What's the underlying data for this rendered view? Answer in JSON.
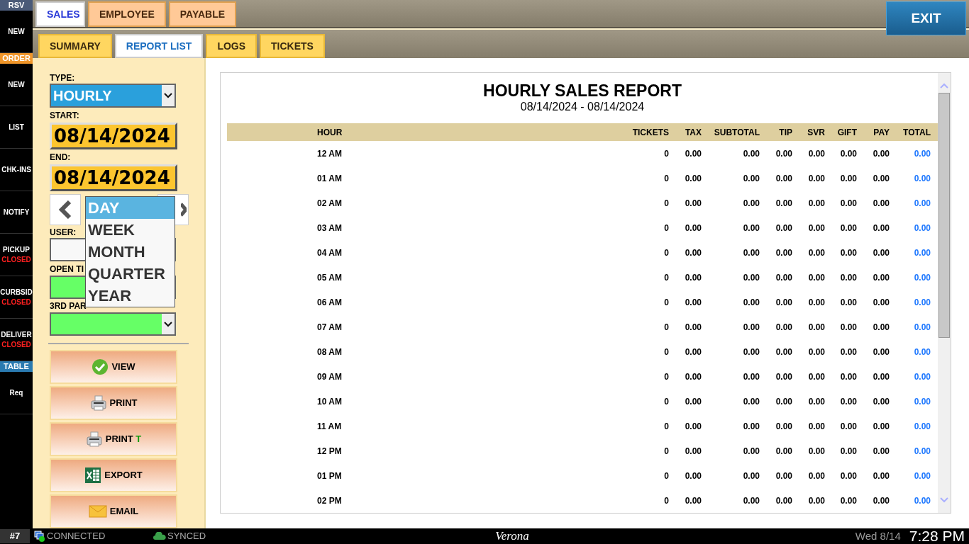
{
  "sidebar": [
    {
      "kind": "header",
      "label": "RSV",
      "color": "#4a5a78"
    },
    {
      "kind": "button",
      "label": "NEW"
    },
    {
      "kind": "header",
      "label": "ORDER",
      "color": "#f0962a"
    },
    {
      "kind": "button",
      "label": "NEW"
    },
    {
      "kind": "button",
      "label": "LIST"
    },
    {
      "kind": "button",
      "label": "CHK-INS"
    },
    {
      "kind": "button",
      "label": "NOTIFY"
    },
    {
      "kind": "button",
      "label": "PICKUP",
      "status": "CLOSED"
    },
    {
      "kind": "button",
      "label": "CURBSID",
      "status": "CLOSED"
    },
    {
      "kind": "button",
      "label": "DELIVER",
      "status": "CLOSED"
    },
    {
      "kind": "header",
      "label": "TABLE",
      "color": "#2a7ab0"
    },
    {
      "kind": "button",
      "label": "Req"
    }
  ],
  "tabs": [
    {
      "label": "SALES",
      "selected": true
    },
    {
      "label": "EMPLOYEE",
      "selected": false
    },
    {
      "label": "PAYABLE",
      "selected": false
    }
  ],
  "exit_button": "EXIT",
  "subtabs": [
    {
      "label": "SUMMARY",
      "selected": false
    },
    {
      "label": "REPORT LIST",
      "selected": true
    },
    {
      "label": "LOGS",
      "selected": false
    },
    {
      "label": "TICKETS",
      "selected": false
    }
  ],
  "filters": {
    "type_label": "TYPE:",
    "type_value": "HOURLY",
    "start_label": "START:",
    "start_value": "08/14/2024",
    "end_label": "END:",
    "end_value": "08/14/2024",
    "user_label": "USER:",
    "open_tickets_label": "OPEN TI",
    "third_party_label": "3RD PAR"
  },
  "period_menu": [
    {
      "label": "DAY",
      "selected": true
    },
    {
      "label": "WEEK",
      "selected": false
    },
    {
      "label": "MONTH",
      "selected": false
    },
    {
      "label": "QUARTER",
      "selected": false
    },
    {
      "label": "YEAR",
      "selected": false
    }
  ],
  "actions": [
    {
      "kind": "check",
      "label": "VIEW"
    },
    {
      "kind": "printer",
      "label": "PRINT"
    },
    {
      "kind": "printer",
      "label": "PRINT",
      "suffix": "T"
    },
    {
      "kind": "excel",
      "label": "EXPORT"
    },
    {
      "kind": "mail",
      "label": "EMAIL"
    }
  ],
  "report": {
    "title": "HOURLY SALES REPORT",
    "date_range": "08/14/2024 - 08/14/2024",
    "columns": [
      "HOUR",
      "TICKETS",
      "TAX",
      "SUBTOTAL",
      "TIP",
      "SVR",
      "GIFT",
      "PAY",
      "TOTAL"
    ],
    "rows": [
      [
        "12 AM",
        "0",
        "0.00",
        "0.00",
        "0.00",
        "0.00",
        "0.00",
        "0.00",
        "0.00"
      ],
      [
        "01 AM",
        "0",
        "0.00",
        "0.00",
        "0.00",
        "0.00",
        "0.00",
        "0.00",
        "0.00"
      ],
      [
        "02 AM",
        "0",
        "0.00",
        "0.00",
        "0.00",
        "0.00",
        "0.00",
        "0.00",
        "0.00"
      ],
      [
        "03 AM",
        "0",
        "0.00",
        "0.00",
        "0.00",
        "0.00",
        "0.00",
        "0.00",
        "0.00"
      ],
      [
        "04 AM",
        "0",
        "0.00",
        "0.00",
        "0.00",
        "0.00",
        "0.00",
        "0.00",
        "0.00"
      ],
      [
        "05 AM",
        "0",
        "0.00",
        "0.00",
        "0.00",
        "0.00",
        "0.00",
        "0.00",
        "0.00"
      ],
      [
        "06 AM",
        "0",
        "0.00",
        "0.00",
        "0.00",
        "0.00",
        "0.00",
        "0.00",
        "0.00"
      ],
      [
        "07 AM",
        "0",
        "0.00",
        "0.00",
        "0.00",
        "0.00",
        "0.00",
        "0.00",
        "0.00"
      ],
      [
        "08 AM",
        "0",
        "0.00",
        "0.00",
        "0.00",
        "0.00",
        "0.00",
        "0.00",
        "0.00"
      ],
      [
        "09 AM",
        "0",
        "0.00",
        "0.00",
        "0.00",
        "0.00",
        "0.00",
        "0.00",
        "0.00"
      ],
      [
        "10 AM",
        "0",
        "0.00",
        "0.00",
        "0.00",
        "0.00",
        "0.00",
        "0.00",
        "0.00"
      ],
      [
        "11 AM",
        "0",
        "0.00",
        "0.00",
        "0.00",
        "0.00",
        "0.00",
        "0.00",
        "0.00"
      ],
      [
        "12 PM",
        "0",
        "0.00",
        "0.00",
        "0.00",
        "0.00",
        "0.00",
        "0.00",
        "0.00"
      ],
      [
        "01 PM",
        "0",
        "0.00",
        "0.00",
        "0.00",
        "0.00",
        "0.00",
        "0.00",
        "0.00"
      ],
      [
        "02 PM",
        "0",
        "0.00",
        "0.00",
        "0.00",
        "0.00",
        "0.00",
        "0.00",
        "0.00"
      ]
    ]
  },
  "status_bar": {
    "station": "#7",
    "connection": "CONNECTED",
    "sync": "SYNCED",
    "location": "Verona",
    "date": "Wed 8/14",
    "time": "7:28 PM"
  }
}
